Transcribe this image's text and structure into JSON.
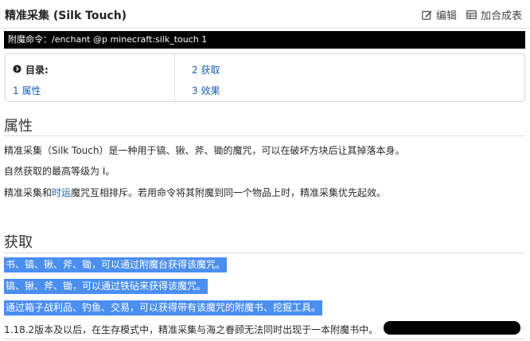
{
  "page": {
    "title": "精准采集 (Silk Touch)"
  },
  "header": {
    "edit_label": "编辑",
    "merge_label": "加合成表",
    "edit_icon": "edit-icon",
    "merge_icon": "table-icon"
  },
  "command": {
    "text": "附魔命令：/enchant @p minecraft:silk_touch 1"
  },
  "toc": {
    "heading": "目录:",
    "icon": "chevron-circle-icon",
    "items": [
      {
        "label": "1 属性"
      },
      {
        "label": "2 获取"
      },
      {
        "label": "3 效果"
      }
    ]
  },
  "sections": {
    "properties": {
      "heading": "属性",
      "p1": "精准采集（Silk Touch）是一种用于镐、锹、斧、锄的魔咒，可以在破坏方块后让其掉落本身。",
      "p2": "自然获取的最高等级为 Ⅰ。",
      "p3_before": "精准采集和",
      "p3_link": "时运",
      "p3_after": "魔咒互相排斥。若用命令将其附魔到同一个物品上时，精准采集优先起效。"
    },
    "obtaining": {
      "heading": "获取",
      "h1": "书、镐、锹、斧、锄，可以通过附魔台获得该魔咒。",
      "h2": "镐、锹、斧、锄，可以通过铁砧来获得该魔咒。",
      "h3": "通过箱子战利品、钓鱼、交易，可以获得带有该魔咒的附魔书、挖掘工具。",
      "p4": "1.18.2版本及以后，在生存模式中，精准采集与海之眷顾无法同时出现于一本附魔书中。"
    }
  },
  "colors": {
    "highlight": "#4a8ef0",
    "link": "#1a5fb4",
    "command_bg": "#000000"
  }
}
